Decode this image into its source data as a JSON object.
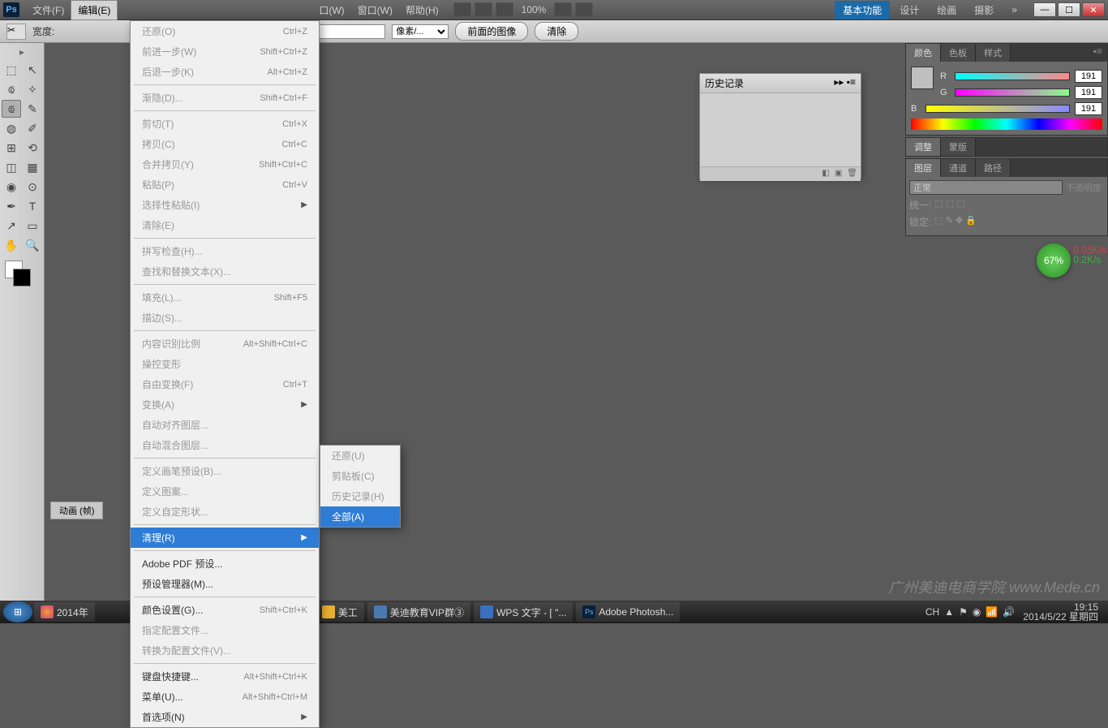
{
  "menubar": {
    "logo": "Ps",
    "items": [
      "文件(F)",
      "编辑(E)",
      "口(W)",
      "窗口(W)",
      "帮助(H)"
    ],
    "active_index": 1,
    "zoom": "100%"
  },
  "workspace": {
    "tabs": [
      "基本功能",
      "设计",
      "绘画",
      "摄影"
    ],
    "active": 0
  },
  "window_controls": {
    "min": "—",
    "max": "☐",
    "close": "✕"
  },
  "options_bar": {
    "width_label": "宽度:",
    "unit": "像素/...",
    "front_image": "前面的图像",
    "clear": "清除"
  },
  "edit_menu": [
    {
      "label": "还原(O)",
      "shortcut": "Ctrl+Z",
      "disabled": true
    },
    {
      "label": "前进一步(W)",
      "shortcut": "Shift+Ctrl+Z",
      "disabled": true
    },
    {
      "label": "后退一步(K)",
      "shortcut": "Alt+Ctrl+Z",
      "disabled": true
    },
    {
      "sep": true
    },
    {
      "label": "渐隐(D)...",
      "shortcut": "Shift+Ctrl+F",
      "disabled": true
    },
    {
      "sep": true
    },
    {
      "label": "剪切(T)",
      "shortcut": "Ctrl+X",
      "disabled": true
    },
    {
      "label": "拷贝(C)",
      "shortcut": "Ctrl+C",
      "disabled": true
    },
    {
      "label": "合并拷贝(Y)",
      "shortcut": "Shift+Ctrl+C",
      "disabled": true
    },
    {
      "label": "粘贴(P)",
      "shortcut": "Ctrl+V",
      "disabled": true
    },
    {
      "label": "选择性粘贴(I)",
      "arrow": true,
      "disabled": true
    },
    {
      "label": "清除(E)",
      "disabled": true
    },
    {
      "sep": true
    },
    {
      "label": "拼写检查(H)...",
      "disabled": true
    },
    {
      "label": "查找和替换文本(X)...",
      "disabled": true
    },
    {
      "sep": true
    },
    {
      "label": "填充(L)...",
      "shortcut": "Shift+F5",
      "disabled": true
    },
    {
      "label": "描边(S)...",
      "disabled": true
    },
    {
      "sep": true
    },
    {
      "label": "内容识别比例",
      "shortcut": "Alt+Shift+Ctrl+C",
      "disabled": true
    },
    {
      "label": "操控变形",
      "disabled": true
    },
    {
      "label": "自由变换(F)",
      "shortcut": "Ctrl+T",
      "disabled": true
    },
    {
      "label": "变换(A)",
      "arrow": true,
      "disabled": true
    },
    {
      "label": "自动对齐图层...",
      "disabled": true
    },
    {
      "label": "自动混合图层...",
      "disabled": true
    },
    {
      "sep": true
    },
    {
      "label": "定义画笔预设(B)...",
      "disabled": true
    },
    {
      "label": "定义图案...",
      "disabled": true
    },
    {
      "label": "定义自定形状...",
      "disabled": true
    },
    {
      "sep": true
    },
    {
      "label": "清理(R)",
      "arrow": true,
      "hover": true
    },
    {
      "sep": true
    },
    {
      "label": "Adobe PDF 预设..."
    },
    {
      "label": "预设管理器(M)..."
    },
    {
      "sep": true
    },
    {
      "label": "颜色设置(G)...",
      "shortcut": "Shift+Ctrl+K"
    },
    {
      "label": "指定配置文件...",
      "disabled": true
    },
    {
      "label": "转换为配置文件(V)...",
      "disabled": true
    },
    {
      "sep": true
    },
    {
      "label": "键盘快捷键...",
      "shortcut": "Alt+Shift+Ctrl+K"
    },
    {
      "label": "菜单(U)...",
      "shortcut": "Alt+Shift+Ctrl+M"
    },
    {
      "label": "首选项(N)",
      "arrow": true
    }
  ],
  "submenu": [
    {
      "label": "还原(U)",
      "disabled": true
    },
    {
      "label": "剪贴板(C)",
      "disabled": true
    },
    {
      "label": "历史记录(H)",
      "disabled": true
    },
    {
      "label": "全部(A)",
      "hover": true
    }
  ],
  "history_panel": {
    "title": "历史记录"
  },
  "color_panel": {
    "tabs": [
      "颜色",
      "色板",
      "样式"
    ],
    "r": {
      "label": "R",
      "value": "191"
    },
    "g": {
      "label": "G",
      "value": "191"
    },
    "b": {
      "label": "B",
      "value": "191"
    }
  },
  "adjust_panel": {
    "tabs": [
      "调整",
      "蒙版"
    ]
  },
  "layers_panel": {
    "tabs": [
      "图层",
      "通道",
      "路径"
    ],
    "mode": "正常",
    "opacity_label": "不透明度:",
    "unify": "统一:",
    "lock": "锁定:"
  },
  "animation_tab": "动画 (帧)",
  "badge": "67%",
  "net": {
    "up": "↑ 0.05K/s",
    "down": "↓ 0.2K/s"
  },
  "taskbar": {
    "items": [
      "2014年",
      "美工",
      "美迪教育VIP群③",
      "WPS 文字 - [ \"...",
      "Adobe Photosh..."
    ],
    "ime": "CH",
    "time": "19:15",
    "date": "2014/5/22 星期四"
  },
  "watermark": "广州美迪电商学院 www.Mede.cn"
}
